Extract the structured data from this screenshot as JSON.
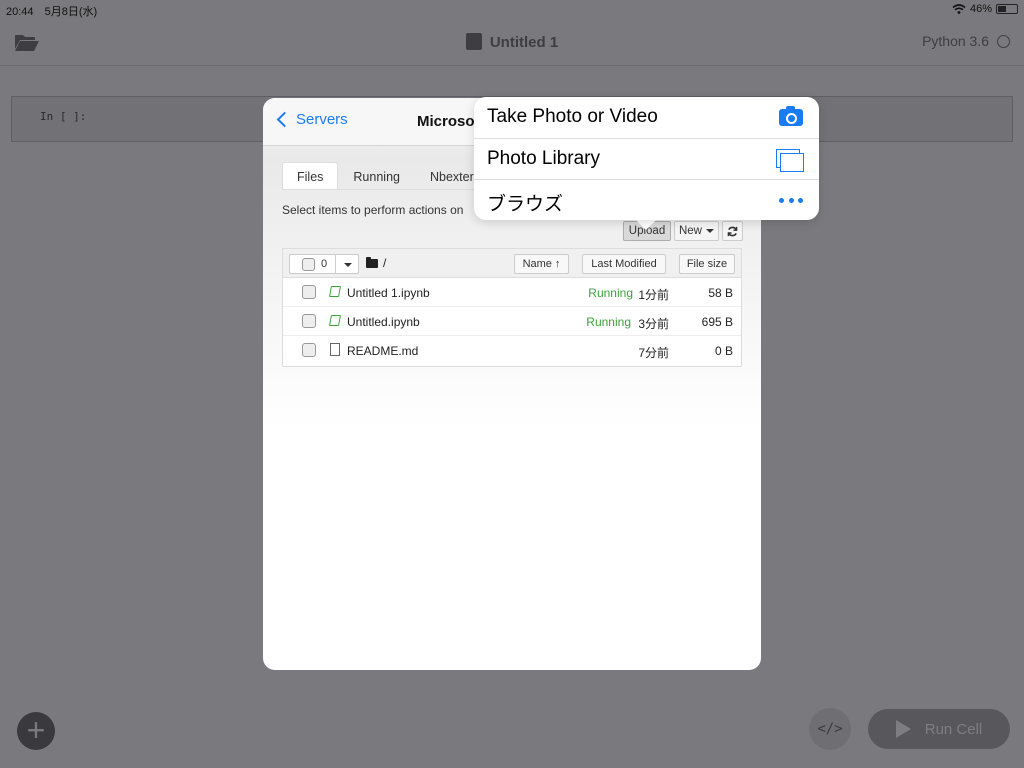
{
  "status_bar": {
    "time": "20:44",
    "date": "5月8日(水)",
    "battery": "46%",
    "battery_level": 0.46
  },
  "app": {
    "title": "Untitled 1",
    "kernel": "Python 3.6",
    "cell_prompt": "In [ ]:",
    "run_cell_label": "Run Cell",
    "code_toggle_label": "</>",
    "add_label": "+"
  },
  "modal": {
    "back_label": "Servers",
    "title": "Microso",
    "tabs": [
      {
        "label": "Files",
        "active": true
      },
      {
        "label": "Running",
        "active": false
      },
      {
        "label": "Nbexter",
        "active": false
      }
    ],
    "hint": "Select items to perform actions on",
    "buttons": {
      "upload": "Upload",
      "new": "New"
    },
    "list_header": {
      "selected_count": "0",
      "path": "/",
      "col_name": "Name",
      "col_modified": "Last Modified",
      "col_size": "File size"
    },
    "files": [
      {
        "name": "Untitled 1.ipynb",
        "type": "notebook",
        "status": "Running",
        "modified": "1分前",
        "size": "58 B"
      },
      {
        "name": "Untitled.ipynb",
        "type": "notebook",
        "status": "Running",
        "modified": "3分前",
        "size": "695 B"
      },
      {
        "name": "README.md",
        "type": "file",
        "status": "",
        "modified": "7分前",
        "size": "0 B"
      }
    ]
  },
  "popover": {
    "items": [
      {
        "label": "Take Photo or Video",
        "icon": "camera-icon"
      },
      {
        "label": "Photo Library",
        "icon": "photo-library-icon"
      },
      {
        "label": "ブラウズ",
        "icon": "more-icon"
      }
    ]
  },
  "colors": {
    "accent": "#1a7cf5",
    "running": "#3aa43a",
    "dim_overlay": "#7a7a7e"
  }
}
